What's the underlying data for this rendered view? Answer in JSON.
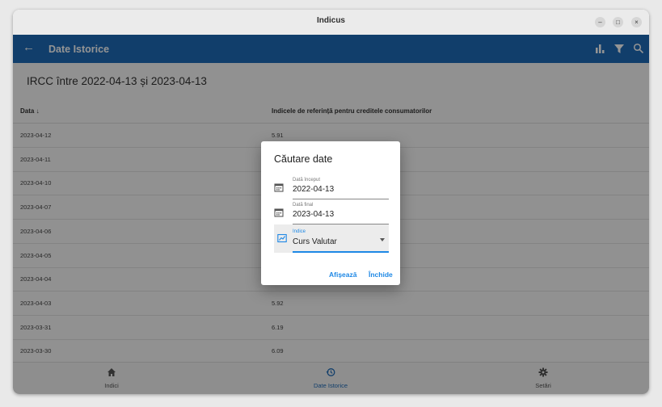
{
  "window": {
    "title": "Indicus"
  },
  "appbar": {
    "title": "Date Istorice"
  },
  "content": {
    "heading": "IRCC între 2022-04-13 și 2023-04-13",
    "columns": {
      "date": "Data ↓",
      "value": "Indicele de referință pentru creditele consumatorilor"
    },
    "rows": [
      {
        "date": "2023-04-12",
        "value": "5.91"
      },
      {
        "date": "2023-04-11",
        "value": ""
      },
      {
        "date": "2023-04-10",
        "value": ""
      },
      {
        "date": "2023-04-07",
        "value": ""
      },
      {
        "date": "2023-04-06",
        "value": ""
      },
      {
        "date": "2023-04-05",
        "value": ""
      },
      {
        "date": "2023-04-04",
        "value": ""
      },
      {
        "date": "2023-04-03",
        "value": "5.92"
      },
      {
        "date": "2023-03-31",
        "value": "6.19"
      },
      {
        "date": "2023-03-30",
        "value": "6.09"
      }
    ]
  },
  "bottom_nav": [
    {
      "label": "Indici",
      "icon": "home-icon"
    },
    {
      "label": "Date Istorice",
      "icon": "history-icon"
    },
    {
      "label": "Setări",
      "icon": "settings-icon"
    }
  ],
  "dialog": {
    "title": "Căutare date",
    "start": {
      "label": "Dată început",
      "value": "2022-04-13"
    },
    "end": {
      "label": "Dată final",
      "value": "2023-04-13"
    },
    "index": {
      "label": "Indice",
      "value": "Curs Valutar"
    },
    "show_button": "Afișează",
    "close_button": "Închide"
  },
  "colors": {
    "primary": "#1e6bb8",
    "accent": "#1e88e5"
  }
}
